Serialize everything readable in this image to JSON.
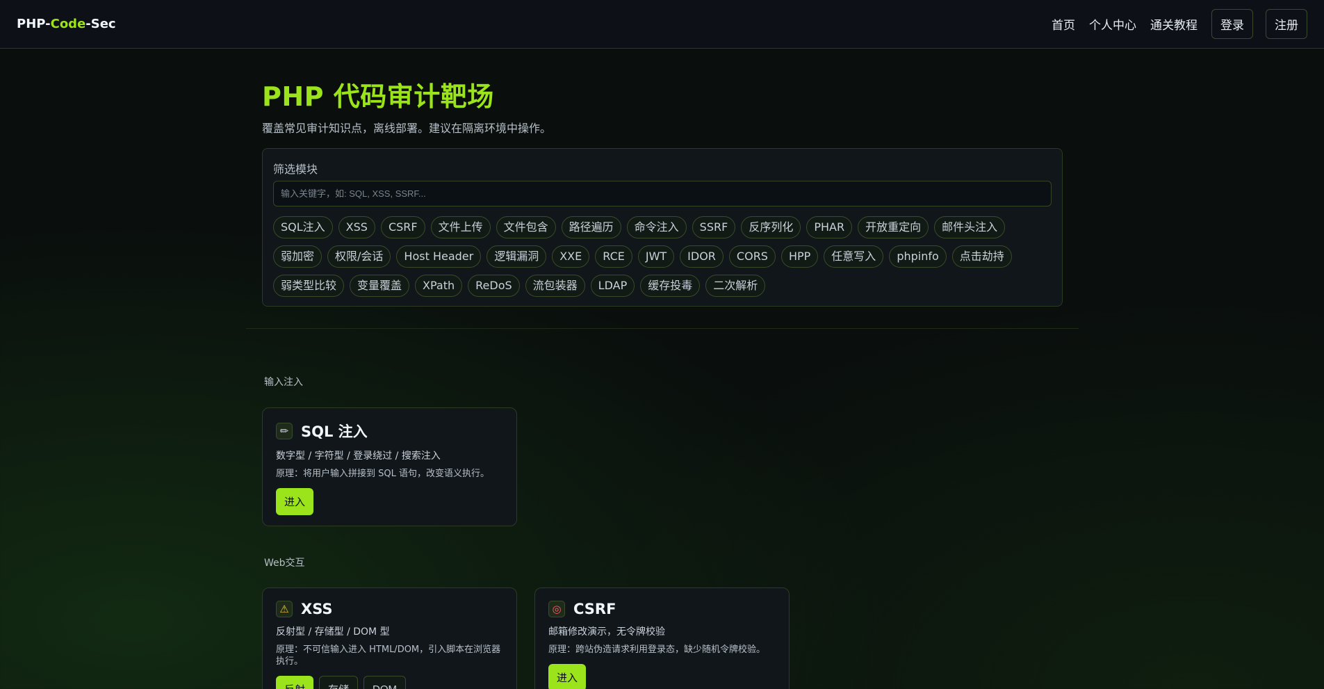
{
  "header": {
    "brand_prefix": "PHP-",
    "brand_accent": "Code",
    "brand_suffix": "-Sec",
    "nav": [
      "首页",
      "个人中心",
      "通关教程"
    ],
    "login": "登录",
    "register": "注册"
  },
  "hero": {
    "title": "PHP 代码审计靶场",
    "subtitle": "覆盖常见审计知识点，离线部署。建议在隔离环境中操作。"
  },
  "filter": {
    "label": "筛选模块",
    "placeholder": "输入关键字，如: SQL, XSS, SSRF...",
    "value": "",
    "tags": [
      "SQL注入",
      "XSS",
      "CSRF",
      "文件上传",
      "文件包含",
      "路径遍历",
      "命令注入",
      "SSRF",
      "反序列化",
      "PHAR",
      "开放重定向",
      "邮件头注入",
      "弱加密",
      "权限/会话",
      "Host Header",
      "逻辑漏洞",
      "XXE",
      "RCE",
      "JWT",
      "IDOR",
      "CORS",
      "HPP",
      "任意写入",
      "phpinfo",
      "点击劫持",
      "弱类型比较",
      "变量覆盖",
      "XPath",
      "ReDoS",
      "流包装器",
      "LDAP",
      "缓存投毒",
      "二次解析"
    ]
  },
  "sections": [
    {
      "label": "输入注入",
      "cards": [
        {
          "icon": "pencil-icon",
          "icon_glyph": "✏",
          "title": "SQL 注入",
          "sub": "数字型 / 字符型 / 登录绕过 / 搜索注入",
          "desc": "原理：将用户输入拼接到 SQL 语句，改变语义执行。",
          "enter": "进入",
          "extra_buttons": []
        }
      ]
    },
    {
      "label": "Web交互",
      "cards": [
        {
          "icon": "warning-icon",
          "icon_glyph": "⚠",
          "title": "XSS",
          "sub": "反射型 / 存储型 / DOM 型",
          "desc": "原理：不可信输入进入 HTML/DOM，引入脚本在浏览器执行。",
          "enter": "反射",
          "extra_buttons": [
            "存储",
            "DOM"
          ]
        },
        {
          "icon": "target-icon",
          "icon_glyph": "◎",
          "title": "CSRF",
          "sub": "邮箱修改演示，无令牌校验",
          "desc": "原理：跨站伪造请求利用登录态，缺少随机令牌校验。",
          "enter": "进入",
          "extra_buttons": []
        }
      ]
    }
  ],
  "colors": {
    "accent": "#9be31a",
    "background": "#0a0f0d",
    "card_border": "#2e3b23"
  }
}
